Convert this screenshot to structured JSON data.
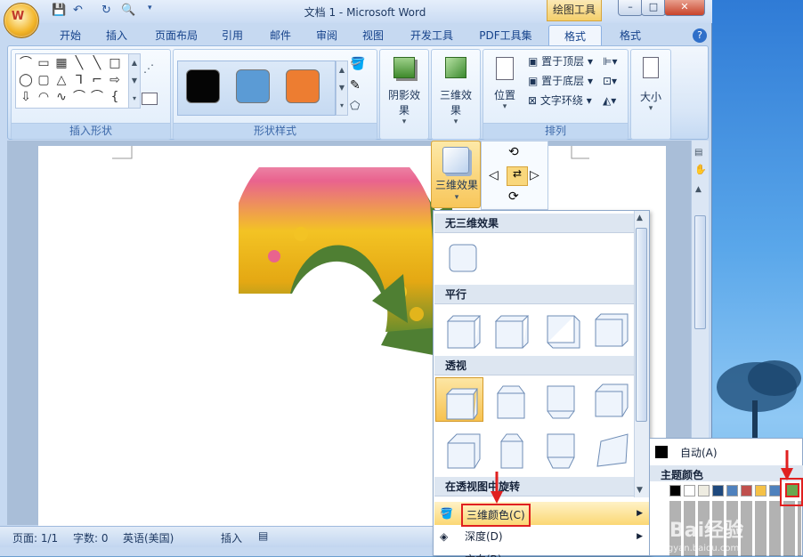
{
  "window": {
    "title": "文档 1 - Microsoft Word",
    "context_tab": "绘图工具",
    "controls": {
      "minimize": "–",
      "maximize": "□",
      "close": "✕"
    },
    "orb_letter": "W"
  },
  "tabs": [
    {
      "label": "开始"
    },
    {
      "label": "插入"
    },
    {
      "label": "页面布局"
    },
    {
      "label": "引用"
    },
    {
      "label": "邮件"
    },
    {
      "label": "审阅"
    },
    {
      "label": "视图"
    },
    {
      "label": "开发工具"
    },
    {
      "label": "PDF工具集"
    },
    {
      "label": "格式"
    },
    {
      "label": "格式"
    }
  ],
  "ribbon": {
    "insert_shapes": {
      "label": "插入形状",
      "shapes": [
        "⌒",
        "▭",
        "▦",
        "╲",
        "╲",
        "□",
        "◯",
        "▢",
        "△",
        "⅂",
        "⌐",
        "⇨",
        "⇩",
        "◠",
        "∿",
        "⌒",
        "⌒",
        "{"
      ]
    },
    "shape_styles": {
      "label": "形状样式",
      "swatches": [
        "#050505",
        "#5b9bd5",
        "#ed7d31"
      ]
    },
    "shadow": {
      "label": "阴影效果"
    },
    "three_d": {
      "label": "三维效果"
    },
    "arrange": {
      "label": "排列",
      "position": "位置",
      "bring_front": "置于顶层",
      "send_back": "置于底层",
      "text_wrap": "文字环绕"
    },
    "size": {
      "label": "大小"
    }
  },
  "three_d_button": {
    "label": "三维效果"
  },
  "gallery": {
    "sections": [
      {
        "title": "无三维效果"
      },
      {
        "title": "平行"
      },
      {
        "title": "透视"
      },
      {
        "title": "在透视图中旋转"
      }
    ],
    "menu": {
      "color": "三维颜色(C)",
      "depth": "深度(D)",
      "direction": "方向(R)"
    }
  },
  "color_panel": {
    "auto_label": "自动(A)",
    "theme_label": "主题颜色",
    "auto_color": "#000000",
    "theme_colors": [
      "#000000",
      "#ffffff",
      "#eeece1",
      "#1f497d",
      "#4f81bd",
      "#c0504d",
      "#9bbb59",
      "#8064a2",
      "#4bacc6",
      "#f79646",
      "#4f6228",
      "#6aa84f"
    ]
  },
  "status": {
    "page": "页面: 1/1",
    "words": "字数: 0",
    "lang": "英语(美国)",
    "mode": "插入"
  },
  "watermark": {
    "text": "Bai经验",
    "sub": "jingyan.baidu.com"
  },
  "colors": {
    "accent": "#e02020",
    "active_tab": "#f1f6fd",
    "highlight": "#f8c65a"
  }
}
